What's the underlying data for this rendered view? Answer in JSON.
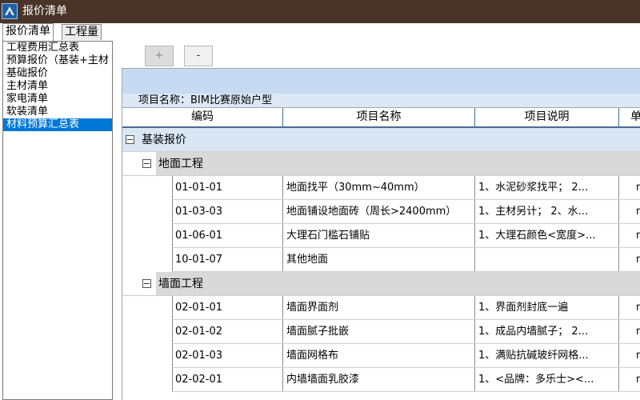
{
  "window": {
    "title": "报价清单"
  },
  "tabs": [
    {
      "label": "报价清单",
      "active": true
    },
    {
      "label": "工程量",
      "active": false
    }
  ],
  "sidebar": {
    "items": [
      {
        "label": "工程费用汇总表"
      },
      {
        "label": "预算报价（基装+主材"
      },
      {
        "label": "基础报价"
      },
      {
        "label": "主材清单"
      },
      {
        "label": "家电清单"
      },
      {
        "label": "软装清单"
      },
      {
        "label": "材料预算汇总表",
        "selected": true
      }
    ]
  },
  "toolbar": {
    "add_label": "+",
    "remove_label": "-"
  },
  "project": {
    "label": "项目名称：BIM比赛原始户型"
  },
  "table": {
    "columns": [
      "编码",
      "项目名称",
      "项目说明",
      "单"
    ],
    "group": {
      "label": "基装报价"
    },
    "subgroups": [
      {
        "label": "地面工程",
        "rows": [
          {
            "code": "01-01-01",
            "name": "地面找平（30mm~40mm）",
            "desc": "1、水泥砂浆找平； 2...",
            "unit": "m"
          },
          {
            "code": "01-03-03",
            "name": "地面铺设地面砖（周长>2400mm）",
            "desc": "1、主材另计； 2、水...",
            "unit": "m"
          },
          {
            "code": "01-06-01",
            "name": "大理石门槛石铺贴",
            "desc": "1、大理石颜色<宽度>...",
            "unit": "m"
          },
          {
            "code": "10-01-07",
            "name": "其他地面",
            "desc": "",
            "unit": "m"
          }
        ]
      },
      {
        "label": "墙面工程",
        "rows": [
          {
            "code": "02-01-01",
            "name": "墙面界面剂",
            "desc": "1、界面剂封底一遍",
            "unit": "m"
          },
          {
            "code": "02-01-02",
            "name": "墙面腻子批嵌",
            "desc": "1、成品内墙腻子； 2...",
            "unit": "m"
          },
          {
            "code": "02-01-03",
            "name": "墙面网格布",
            "desc": "1、满贴抗碱玻纤网格...",
            "unit": "m"
          },
          {
            "code": "02-02-01",
            "name": "内墙墙面乳胶漆",
            "desc": "1、<品牌：多乐士><...",
            "unit": "m"
          }
        ]
      }
    ]
  },
  "colors": {
    "titlebar": "#4a3428",
    "selection": "#0078d7",
    "table_header_bar": "#c7daf2",
    "group_row": "#d9e7f5",
    "subgroup_row": "#d9d9d9"
  }
}
